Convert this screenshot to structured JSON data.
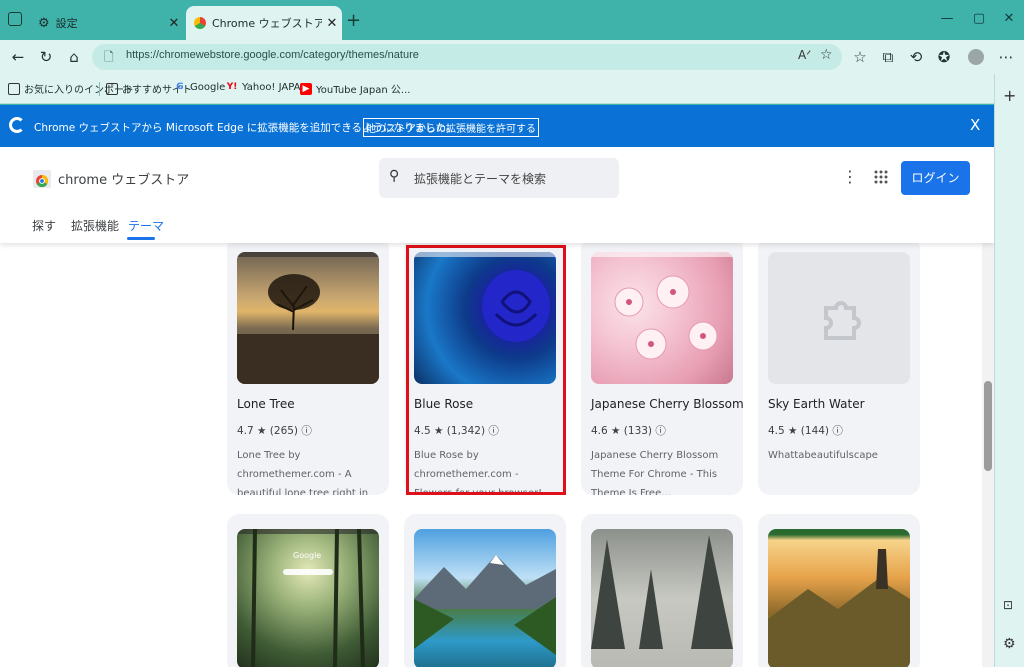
{
  "tabs": [
    {
      "label": "設定",
      "icon": "gear-icon"
    },
    {
      "label": "Chrome ウェブストア - 自然と風景",
      "icon": "chrome-webstore-icon"
    }
  ],
  "address_bar": {
    "url": "https://chromewebstore.google.com/category/themes/nature"
  },
  "favorites": [
    {
      "label": "お気に入りのインポート"
    },
    {
      "label": "おすすめサイト"
    },
    {
      "label": "Google"
    },
    {
      "label": "Yahoo! JAPAN"
    },
    {
      "label": "YouTube Japan 公..."
    }
  ],
  "notification": {
    "message": "Chrome ウェブストアから Microsoft Edge に拡張機能を追加できるようになりました。",
    "action": "他のストアからの拡張機能を許可する",
    "close": "X"
  },
  "store": {
    "name": "chrome ウェブストア",
    "search_placeholder": "拡張機能とテーマを検索",
    "login": "ログイン",
    "nav": [
      "探す",
      "拡張機能",
      "テーマ"
    ]
  },
  "themes": [
    {
      "name": "Lone Tree",
      "rating": "4.7",
      "count": "(265)",
      "desc": "Lone Tree by chromethemer.com - A beautiful lone tree right in your..."
    },
    {
      "name": "Blue Rose",
      "rating": "4.5",
      "count": "(1,342)",
      "desc": "Blue Rose by chromethemer.com - Flowers for your browser! This..."
    },
    {
      "name": "Japanese Cherry Blossom",
      "rating": "4.6",
      "count": "(133)",
      "desc": "Japanese Cherry Blossom Theme For Chrome - This Theme Is Free..."
    },
    {
      "name": "Sky Earth Water",
      "rating": "4.5",
      "count": "(144)",
      "desc": "Whattabeautifulscape"
    }
  ],
  "second_row_thumb_text": "Google",
  "colors": {
    "accent": "#1a73e8",
    "frame": "#3fb3aa",
    "notification": "#0a72d6",
    "highlight": "#e0101a"
  }
}
